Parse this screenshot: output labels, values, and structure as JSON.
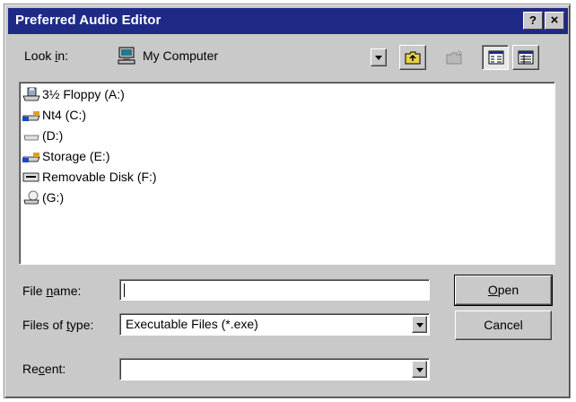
{
  "dialog": {
    "title": "Preferred Audio Editor",
    "help_label": "?",
    "close_label": "×"
  },
  "look_in": {
    "label_pre": "Look ",
    "label_accel": "i",
    "label_post": "n:",
    "value": "My Computer"
  },
  "files": [
    {
      "name": "3½ Floppy (A:)",
      "icon": "floppy-drive-icon"
    },
    {
      "name": "Nt4 (C:)",
      "icon": "hard-drive-icon"
    },
    {
      "name": "(D:)",
      "icon": "hard-drive-icon"
    },
    {
      "name": "Storage (E:)",
      "icon": "hard-drive-icon"
    },
    {
      "name": "Removable Disk (F:)",
      "icon": "removable-drive-icon"
    },
    {
      "name": "(G:)",
      "icon": "network-drive-icon"
    }
  ],
  "file_name": {
    "label_pre": "File ",
    "label_accel": "n",
    "label_post": "ame:",
    "value": ""
  },
  "files_of_type": {
    "label_pre": "Files of ",
    "label_accel": "t",
    "label_post": "ype:",
    "value": "Executable Files (*.exe)"
  },
  "recent": {
    "label_pre": "Re",
    "label_accel": "c",
    "label_post": "ent:",
    "value": ""
  },
  "buttons": {
    "open_accel": "O",
    "open_rest": "pen",
    "cancel": "Cancel"
  },
  "colors": {
    "titlebar": "#1f2a86",
    "face": "#c9c9c9"
  }
}
